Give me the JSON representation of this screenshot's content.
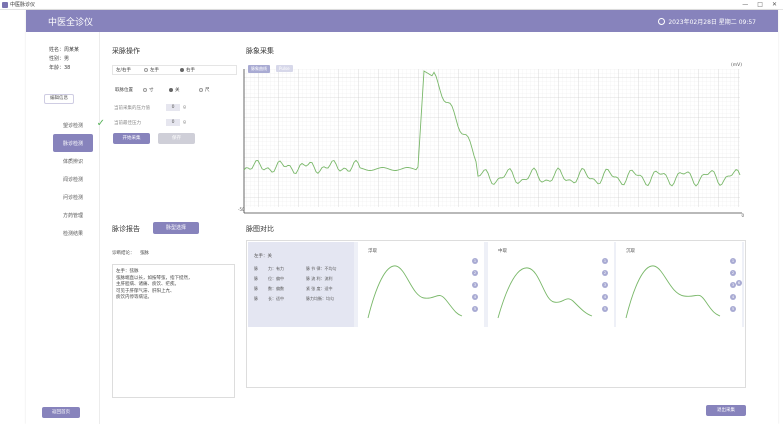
{
  "window": {
    "title": "中医脉诊仪",
    "controls": [
      "—",
      "□",
      "✕"
    ]
  },
  "header": {
    "title": "中医全诊仪",
    "datetime": "2023年02月28日 星期二 09:57"
  },
  "patient": {
    "name": "姓名：周某某",
    "gender": "性别：男",
    "age": "年龄：38",
    "edit_button": "编辑信息"
  },
  "sidebar": {
    "items": [
      {
        "label": "望诊检测",
        "state": "done"
      },
      {
        "label": "脉诊检测",
        "state": "active"
      },
      {
        "label": "体质辨识",
        "state": "normal"
      },
      {
        "label": "闻诊检测",
        "state": "normal"
      },
      {
        "label": "问诊检测",
        "state": "normal"
      },
      {
        "label": "方药管理",
        "state": "normal"
      },
      {
        "label": "检测结果",
        "state": "normal"
      }
    ],
    "bottom_button": "返回首页"
  },
  "acquisition": {
    "title": "采脉操作",
    "hand_label": "左/右手",
    "hand_options": [
      "左手",
      "右手"
    ],
    "hand_selected": "右手",
    "position_label": "取脉位置",
    "position_options": [
      "寸",
      "关",
      "尺"
    ],
    "position_selected": "关",
    "current_pressure_label": "当前采集的压力值",
    "current_pressure_value": "0",
    "current_pressure_unit": "g",
    "best_pressure_label": "当前最佳压力",
    "best_pressure_value": "0",
    "best_pressure_unit": "g",
    "start_button": "开始采集",
    "save_button": "保存"
  },
  "waveform": {
    "title": "脉象采集",
    "tag_1": "脉象曲线",
    "tag_2": "Pulse",
    "y_unit": "(mV)",
    "y_min_label": "-50",
    "x_max_label": "0"
  },
  "report": {
    "title": "脉诊报告",
    "type_button": "脉型选择",
    "result_label": "诊断结论：",
    "result_value": "弦脉",
    "lines": [
      "左手：弦脉",
      "弦脉端直以长，如按琴弦，指下挺然，",
      "主肝胆病、诸痛、痰饮、疟疾。",
      "可见于肝郁气滞、肝阳上亢、",
      "痰饮内停等病证。"
    ]
  },
  "comparison": {
    "title": "脉图对比",
    "left": {
      "hand": "左手：关",
      "rows": [
        [
          "脉",
          "力：有力",
          "脉 节 律：不均匀"
        ],
        [
          "脉",
          "位：偏中",
          "脉 流 利：流利"
        ],
        [
          "脉",
          "数：偏数",
          "紧 张 度：适中"
        ],
        [
          "脉",
          "长：适中",
          "脉力均衡：均匀"
        ]
      ]
    },
    "panels": [
      {
        "label": "浮取",
        "dots": [
          "1",
          "2",
          "3",
          "4",
          "5"
        ]
      },
      {
        "label": "中取",
        "dots": [
          "1",
          "2",
          "3",
          "4",
          "5"
        ]
      },
      {
        "label": "沉取",
        "dots": [
          "1",
          "2",
          "3",
          "4",
          "5"
        ]
      }
    ],
    "side_dot": "6"
  },
  "footer": {
    "exit_button": "退出采集"
  },
  "colors": {
    "accent": "#8783bc",
    "wave": "#7ab86a",
    "check": "#57b35a"
  }
}
